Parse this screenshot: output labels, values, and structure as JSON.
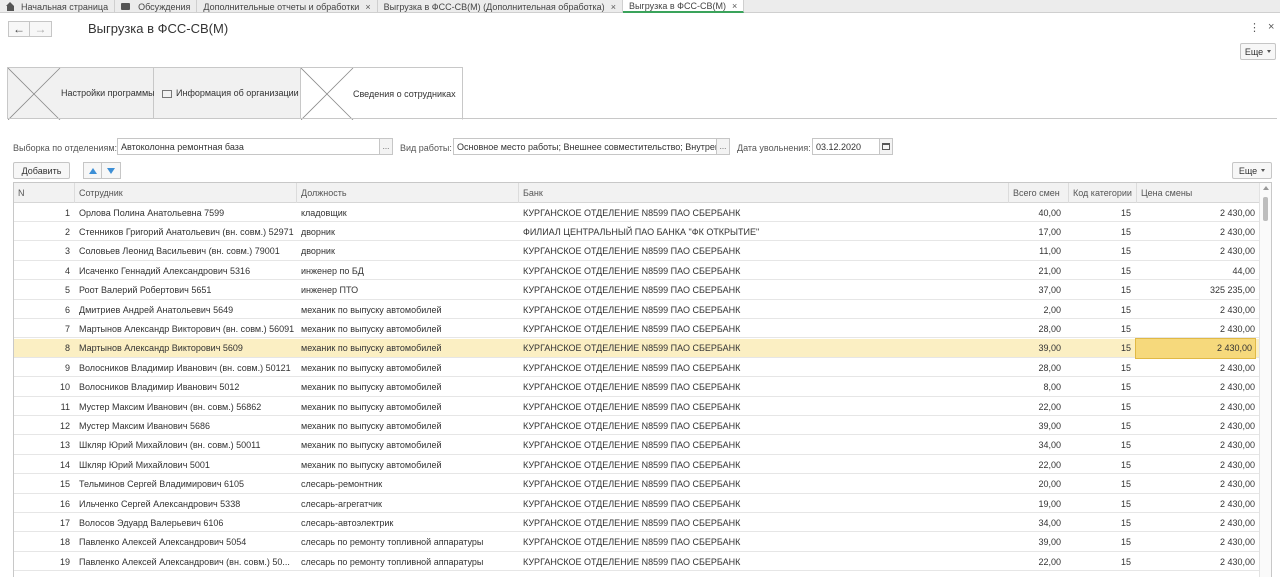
{
  "top_tabs": [
    {
      "label": "Начальная страница",
      "closable": false,
      "icon": "home-icon"
    },
    {
      "label": "Обсуждения",
      "closable": false,
      "icon": "chat-icon"
    },
    {
      "label": "Дополнительные отчеты и обработки",
      "closable": true
    },
    {
      "label": "Выгрузка в ФСС-СВ(М) (Дополнительная обработка)",
      "closable": true
    },
    {
      "label": "Выгрузка в ФСС-СВ(М)",
      "closable": true,
      "active": true
    }
  ],
  "close_glyph": "×",
  "header": {
    "back_glyph": "←",
    "forward_glyph": "→",
    "title": "Выгрузка в ФСС-СВ(М)",
    "dots_glyph": "⋮",
    "close_glyph": "×",
    "more_label": "Еще"
  },
  "page_tabs": [
    {
      "label": "Настройки программы"
    },
    {
      "label": "Информация об организации"
    },
    {
      "label": "Сведения о сотрудниках",
      "active": true
    }
  ],
  "filters": {
    "department_label": "Выборка по отделениям:",
    "department_value": "Автоколонна ремонтная база",
    "work_type_label": "Вид работы:",
    "work_type_value": "Основное место работы; Внешнее совместительство; Внутренн",
    "dismissal_label": "Дата увольнения:",
    "dismissal_value": "03.12.2020",
    "select_glyph": "..."
  },
  "toolbar": {
    "add_label": "Добавить",
    "more_label": "Еще"
  },
  "table": {
    "columns": [
      "N",
      "Сотрудник",
      "Должность",
      "Банк",
      "Всего смен",
      "Код категории",
      "Цена смены"
    ],
    "selected_row": 7,
    "rows": [
      [
        "1",
        "Орлова Полина Анатольевна 7599",
        "кладовщик",
        "КУРГАНСКОЕ ОТДЕЛЕНИЕ N8599 ПАО СБЕРБАНК",
        "40,00",
        "15",
        "2 430,00"
      ],
      [
        "2",
        "Стенников Григорий Анатольевич (вн. совм.) 52971",
        "дворник",
        "ФИЛИАЛ ЦЕНТРАЛЬНЫЙ ПАО БАНКА \"ФК ОТКРЫТИЕ\"",
        "17,00",
        "15",
        "2 430,00"
      ],
      [
        "3",
        "Соловьев Леонид Васильевич (вн. совм.) 79001",
        "дворник",
        "КУРГАНСКОЕ ОТДЕЛЕНИЕ N8599 ПАО СБЕРБАНК",
        "11,00",
        "15",
        "2 430,00"
      ],
      [
        "4",
        "Исаченко Геннадий Александрович 5316",
        "инженер по БД",
        "КУРГАНСКОЕ ОТДЕЛЕНИЕ N8599 ПАО СБЕРБАНК",
        "21,00",
        "15",
        "44,00"
      ],
      [
        "5",
        "Роот Валерий Робертович 5651",
        "инженер ПТО",
        "КУРГАНСКОЕ ОТДЕЛЕНИЕ N8599 ПАО СБЕРБАНК",
        "37,00",
        "15",
        "325 235,00"
      ],
      [
        "6",
        "Дмитриев Андрей Анатольевич 5649",
        "механик по выпуску автомобилей",
        "КУРГАНСКОЕ ОТДЕЛЕНИЕ N8599 ПАО СБЕРБАНК",
        "2,00",
        "15",
        "2 430,00"
      ],
      [
        "7",
        "Мартынов Александр Викторович (вн. совм.) 56091",
        "механик по выпуску автомобилей",
        "КУРГАНСКОЕ ОТДЕЛЕНИЕ N8599 ПАО СБЕРБАНК",
        "28,00",
        "15",
        "2 430,00"
      ],
      [
        "8",
        "Мартынов Александр Викторович 5609",
        "механик по выпуску автомобилей",
        "КУРГАНСКОЕ ОТДЕЛЕНИЕ N8599 ПАО СБЕРБАНК",
        "39,00",
        "15",
        "2 430,00"
      ],
      [
        "9",
        "Волосников Владимир Иванович (вн. совм.) 50121",
        "механик по выпуску автомобилей",
        "КУРГАНСКОЕ ОТДЕЛЕНИЕ N8599 ПАО СБЕРБАНК",
        "28,00",
        "15",
        "2 430,00"
      ],
      [
        "10",
        "Волосников Владимир Иванович 5012",
        "механик по выпуску автомобилей",
        "КУРГАНСКОЕ ОТДЕЛЕНИЕ N8599 ПАО СБЕРБАНК",
        "8,00",
        "15",
        "2 430,00"
      ],
      [
        "11",
        "Мустер Максим Иванович (вн. совм.) 56862",
        "механик по выпуску автомобилей",
        "КУРГАНСКОЕ ОТДЕЛЕНИЕ N8599 ПАО СБЕРБАНК",
        "22,00",
        "15",
        "2 430,00"
      ],
      [
        "12",
        "Мустер Максим Иванович 5686",
        "механик по выпуску автомобилей",
        "КУРГАНСКОЕ ОТДЕЛЕНИЕ N8599 ПАО СБЕРБАНК",
        "39,00",
        "15",
        "2 430,00"
      ],
      [
        "13",
        "Шкляр Юрий Михайлович (вн. совм.) 50011",
        "механик по выпуску автомобилей",
        "КУРГАНСКОЕ ОТДЕЛЕНИЕ N8599 ПАО СБЕРБАНК",
        "34,00",
        "15",
        "2 430,00"
      ],
      [
        "14",
        "Шкляр Юрий Михайлович 5001",
        "механик по выпуску автомобилей",
        "КУРГАНСКОЕ ОТДЕЛЕНИЕ N8599 ПАО СБЕРБАНК",
        "22,00",
        "15",
        "2 430,00"
      ],
      [
        "15",
        "Тельминов Сергей Владимирович 6105",
        "слесарь-ремонтник",
        "КУРГАНСКОЕ ОТДЕЛЕНИЕ N8599 ПАО СБЕРБАНК",
        "20,00",
        "15",
        "2 430,00"
      ],
      [
        "16",
        "Ильченко Сергей Александрович 5338",
        "слесарь-агрегатчик",
        "КУРГАНСКОЕ ОТДЕЛЕНИЕ N8599 ПАО СБЕРБАНК",
        "19,00",
        "15",
        "2 430,00"
      ],
      [
        "17",
        "Волосов Эдуард Валерьевич 6106",
        "слесарь-автоэлектрик",
        "КУРГАНСКОЕ ОТДЕЛЕНИЕ N8599 ПАО СБЕРБАНК",
        "34,00",
        "15",
        "2 430,00"
      ],
      [
        "18",
        "Павленко Алексей Александрович 5054",
        "слесарь по ремонту топливной аппаратуры",
        "КУРГАНСКОЕ ОТДЕЛЕНИЕ N8599 ПАО СБЕРБАНК",
        "39,00",
        "15",
        "2 430,00"
      ],
      [
        "19",
        "Павленко Алексей Александрович (вн. совм.) 50...",
        "слесарь по ремонту топливной аппаратуры",
        "КУРГАНСКОЕ ОТДЕЛЕНИЕ N8599 ПАО СБЕРБАНК",
        "22,00",
        "15",
        "2 430,00"
      ]
    ]
  },
  "colors": {
    "selected_row": "#fbefc3",
    "selected_cell": "#f6d97c",
    "active_tab_underline": "#3aa35b",
    "arrow_blue": "#3d8fd6"
  }
}
